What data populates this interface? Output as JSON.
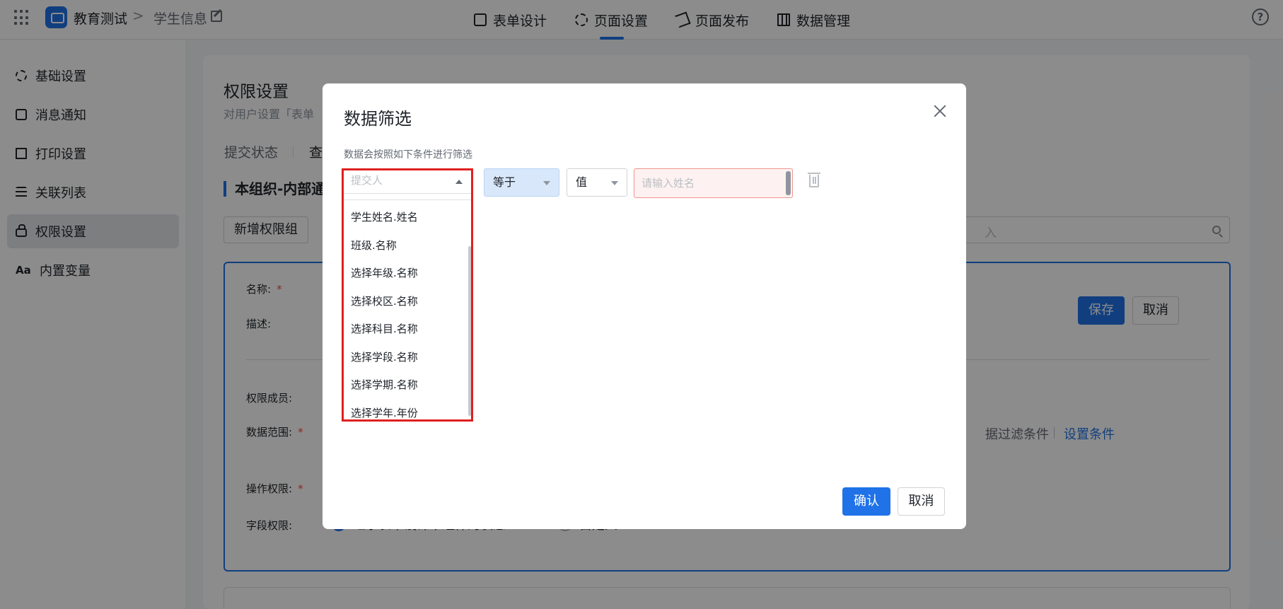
{
  "header": {
    "app_name": "教育测试",
    "breadcrumb_sep": ">",
    "page_name": "学生信息",
    "tabs": [
      {
        "label": "表单设计"
      },
      {
        "label": "页面设置"
      },
      {
        "label": "页面发布"
      },
      {
        "label": "数据管理"
      }
    ],
    "help_symbol": "?"
  },
  "sidebar": {
    "items": [
      {
        "label": "基础设置",
        "icon": "gear-icon"
      },
      {
        "label": "消息通知",
        "icon": "message-icon"
      },
      {
        "label": "打印设置",
        "icon": "printer-icon"
      },
      {
        "label": "关联列表",
        "icon": "list-icon"
      },
      {
        "label": "权限设置",
        "icon": "lock-icon"
      },
      {
        "label": "内置变量",
        "icon": "variable-icon",
        "glyph": "Aa"
      }
    ]
  },
  "main": {
    "title": "权限设置",
    "desc": "对用户设置「表单",
    "tab_submit": "提交状态",
    "tab_query": "查",
    "org_title": "本组织-内部通",
    "add_group": "新增权限组",
    "search_placeholder_visible": "入",
    "labels": {
      "name": "名称:",
      "desc": "描述:",
      "members": "权限成员:",
      "range": "数据范围:",
      "actions": "操作权限:",
      "fields": "字段权限:"
    },
    "required_mark": "*",
    "save": "保存",
    "cancel": "取消",
    "filter_text": "据过滤条件",
    "set_condition": "设置条件",
    "radio_inherit": "继承表单设计中组件的状态",
    "radio_custom": "自定义"
  },
  "modal": {
    "title": "数据筛选",
    "hint": "数据会按照如下条件进行筛选",
    "field_placeholder": "提交人",
    "operator": "等于",
    "value_type": "值",
    "input_placeholder": "请输入姓名",
    "dropdown_options": [
      "学生姓名.姓名",
      "班级.名称",
      "选择年级.名称",
      "选择校区.名称",
      "选择科目.名称",
      "选择学段.名称",
      "选择学期.名称",
      "选择学年.年份"
    ],
    "confirm": "确认",
    "cancel": "取消"
  },
  "colors": {
    "accent": "#1f72e8",
    "highlight": "#e01f1f",
    "error_border": "#f0948f"
  }
}
